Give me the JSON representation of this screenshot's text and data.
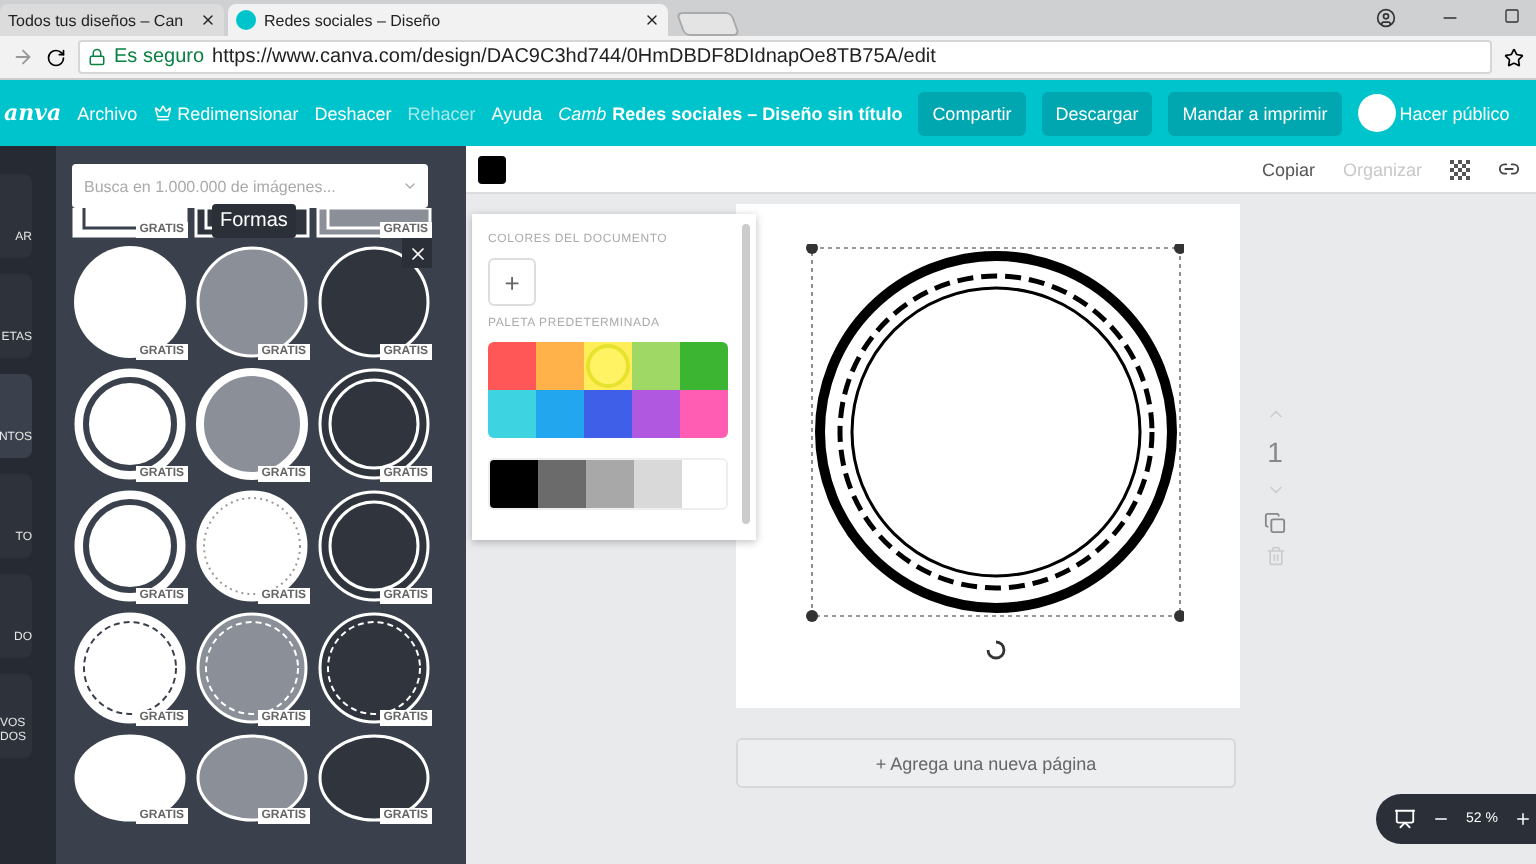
{
  "browser": {
    "tabs": [
      {
        "title": "Todos tus diseños – Can",
        "selected": false
      },
      {
        "title": "Redes sociales – Diseño",
        "selected": true
      }
    ],
    "security": "Es seguro",
    "url": "https://www.canva.com/design/DAC9C3hd744/0HmDBDF8DIdnapOe8TB75A/edit"
  },
  "toolbar": {
    "logo": "anva",
    "menu": [
      {
        "label": "Archivo",
        "disabled": false,
        "kind": "text"
      },
      {
        "label": "Redimensionar",
        "disabled": false,
        "kind": "crown"
      },
      {
        "label": "Deshacer",
        "disabled": false,
        "kind": "text"
      },
      {
        "label": "Rehacer",
        "disabled": true,
        "kind": "text"
      },
      {
        "label": "Ayuda",
        "disabled": false,
        "kind": "text"
      },
      {
        "label": "Camb",
        "disabled": false,
        "kind": "italic"
      }
    ],
    "title": "Redes sociales – Diseño sin título",
    "buttons": [
      "Compartir",
      "Descargar",
      "Mandar a imprimir"
    ],
    "public_label": "Hacer público"
  },
  "rail": {
    "items": [
      {
        "label": "AR",
        "selected": false
      },
      {
        "label": "ETAS",
        "selected": false
      },
      {
        "label": "NTOS",
        "selected": true
      },
      {
        "label": "TO",
        "selected": false
      },
      {
        "label": "DO",
        "selected": false
      },
      {
        "label": "VOS DOS",
        "selected": false
      }
    ]
  },
  "panel": {
    "search": {
      "placeholder": "Busca en 1.000.000 de imágenes..."
    },
    "tooltip": "Formas",
    "shapes": [
      {
        "color": "#ffffff",
        "kind": "frame",
        "badge": "GRATIS"
      },
      {
        "color": "#2f343d",
        "kind": "frame"
      },
      {
        "color": "#8a8f98",
        "kind": "frame",
        "badge": "GRATIS"
      },
      {
        "color": "#ffffff",
        "kind": "plain",
        "badge": "GRATIS"
      },
      {
        "color": "#8a8f98",
        "kind": "outline",
        "badge": "GRATIS"
      },
      {
        "color": "#2f343d",
        "kind": "outline",
        "badge": "GRATIS"
      },
      {
        "color": "#ffffff",
        "kind": "inner-ring",
        "badge": "GRATIS"
      },
      {
        "color": "#8a8f98",
        "kind": "thick-ring",
        "badge": "GRATIS"
      },
      {
        "color": "#2f343d",
        "kind": "double",
        "badge": "GRATIS"
      },
      {
        "color": "#ffffff",
        "kind": "inner-ring",
        "badge": "GRATIS"
      },
      {
        "color": "#ffffff",
        "kind": "dotted",
        "badge": "GRATIS"
      },
      {
        "color": "#2f343d",
        "kind": "double",
        "badge": "GRATIS"
      },
      {
        "color": "#ffffff",
        "kind": "dashed",
        "badge": "GRATIS"
      },
      {
        "color": "#8a8f98",
        "kind": "dashed",
        "badge": "GRATIS"
      },
      {
        "color": "#2f343d",
        "kind": "dashed",
        "badge": "GRATIS"
      },
      {
        "color": "#ffffff",
        "kind": "ellipse",
        "badge": "GRATIS"
      },
      {
        "color": "#8a8f98",
        "kind": "ellipse",
        "badge": "GRATIS"
      },
      {
        "color": "#2f343d",
        "kind": "ellipse",
        "badge": "GRATIS"
      }
    ]
  },
  "context_bar": {
    "color": "#000000",
    "actions": [
      {
        "label": "Copiar",
        "disabled": false
      },
      {
        "label": "Organizar",
        "disabled": true
      }
    ]
  },
  "color_popup": {
    "document_heading": "COLORES DEL DOCUMENTO",
    "add_label": "+",
    "palette_heading": "PALETA PREDETERMINADA",
    "palette": [
      {
        "color": "#ff5757",
        "selected": false
      },
      {
        "color": "#ffb14a",
        "selected": false
      },
      {
        "color": "#ffee58",
        "selected": true
      },
      {
        "color": "#a0d866",
        "selected": false
      },
      {
        "color": "#3cb533",
        "selected": false
      },
      {
        "color": "#3ed3e0",
        "selected": false
      },
      {
        "color": "#22a6ee",
        "selected": false
      },
      {
        "color": "#3f5fe8",
        "selected": false
      },
      {
        "color": "#b058e0",
        "selected": false
      },
      {
        "color": "#ff5cb3",
        "selected": false
      }
    ],
    "greys": [
      {
        "color": "#000000"
      },
      {
        "color": "#6b6b6b"
      },
      {
        "color": "#a8a8a8"
      },
      {
        "color": "#d9d9d9"
      },
      {
        "color": "#ffffff"
      }
    ]
  },
  "page": {
    "number": "1",
    "add_page": "+ Agrega una nueva página"
  },
  "zoom": {
    "reading": "52 %"
  }
}
